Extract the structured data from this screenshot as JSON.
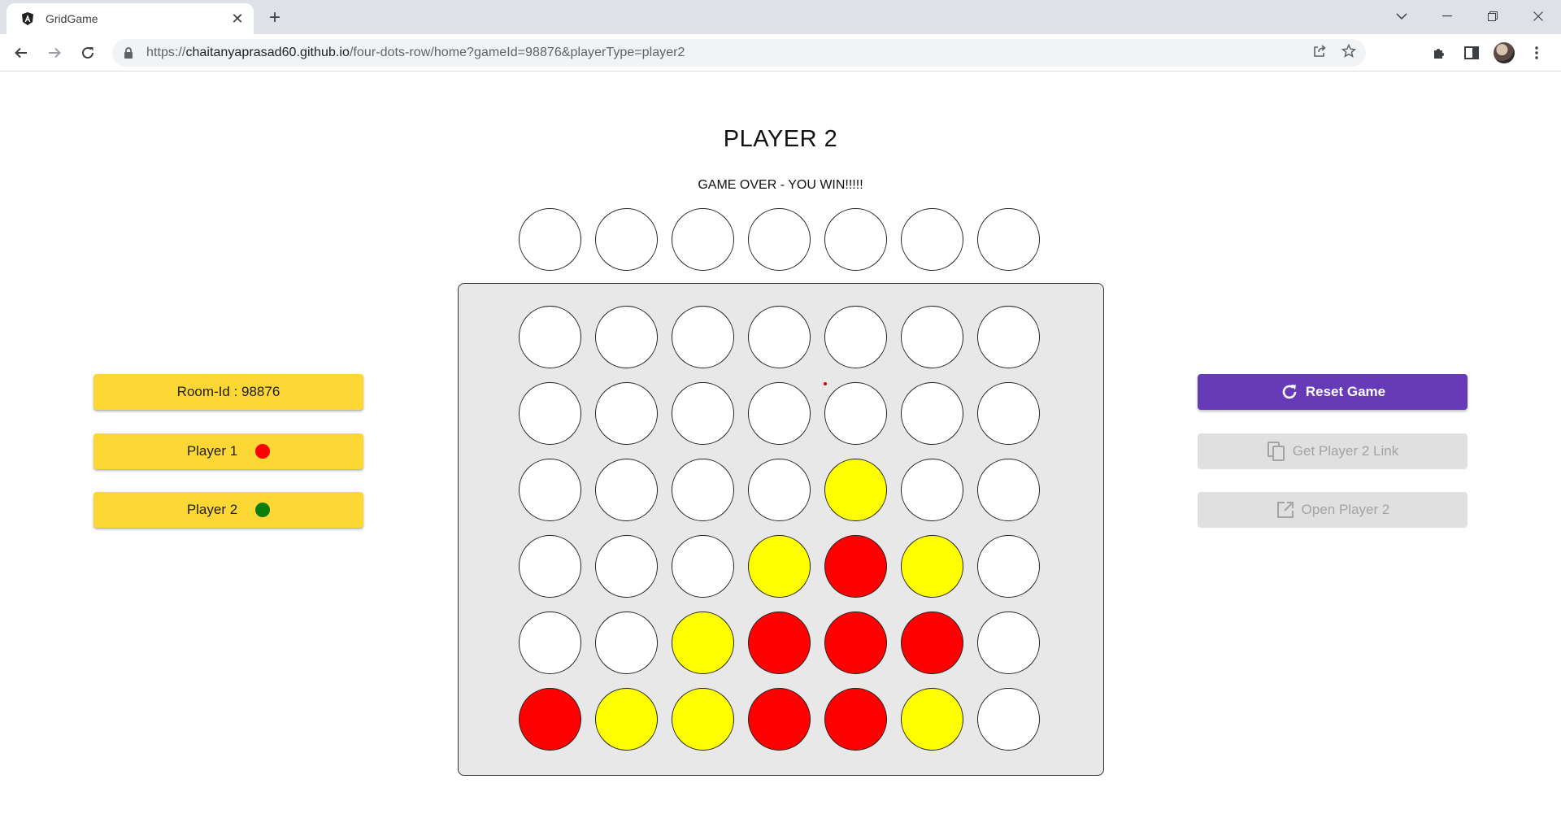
{
  "browser": {
    "tab_title": "GridGame",
    "url_scheme": "https://",
    "url_host": "chaitanyaprasad60.github.io",
    "url_path": "/four-dots-row/home?gameId=98876&playerType=player2"
  },
  "page": {
    "title": "PLAYER 2",
    "status": "GAME OVER - YOU WIN!!!!!"
  },
  "left_panel": {
    "room_label": "Room-Id : 98876",
    "players": [
      {
        "label": "Player 1",
        "color": "#ff0000"
      },
      {
        "label": "Player 2",
        "color": "#0a7d0a"
      }
    ]
  },
  "right_panel": {
    "reset_label": "Reset Game",
    "get_link_label": "Get Player 2 Link",
    "open_player_label": "Open Player 2"
  },
  "board": {
    "columns": 7,
    "rows": 6,
    "cells": [
      [
        "empty",
        "empty",
        "empty",
        "empty",
        "empty",
        "empty",
        "empty"
      ],
      [
        "empty",
        "empty",
        "empty",
        "empty",
        "empty",
        "empty",
        "empty"
      ],
      [
        "empty",
        "empty",
        "empty",
        "empty",
        "yellow",
        "empty",
        "empty"
      ],
      [
        "empty",
        "empty",
        "empty",
        "yellow",
        "red",
        "yellow",
        "empty"
      ],
      [
        "empty",
        "empty",
        "yellow",
        "red",
        "red",
        "red",
        "empty"
      ],
      [
        "red",
        "yellow",
        "yellow",
        "red",
        "red",
        "yellow",
        "empty"
      ]
    ],
    "piece_colors": {
      "red": "#ff0000",
      "yellow": "#ffff00",
      "empty": "#ffffff"
    }
  },
  "theme": {
    "card_yellow": "#fdd835",
    "primary_purple": "#673ab7",
    "disabled_gray": "#e0e0e0"
  }
}
